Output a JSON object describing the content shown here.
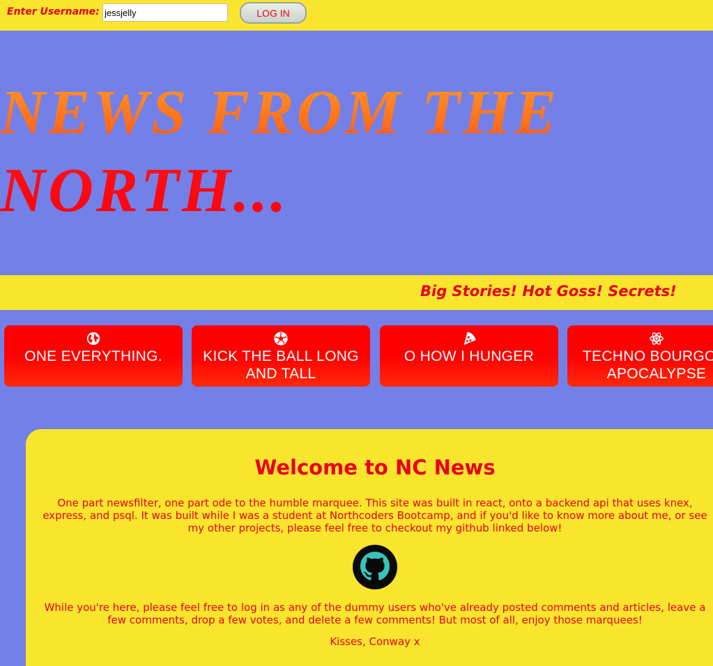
{
  "login": {
    "label": "Enter Username:",
    "username_value": "jessjelly",
    "button_label": "LOG IN"
  },
  "hero": {
    "title": "NEWS FROM THE NORTH..."
  },
  "marquee": {
    "text": "Big Stories! Hot Goss! Secrets!"
  },
  "topics": [
    {
      "label": "ONE EVERYTHING.",
      "icon": "globe-icon"
    },
    {
      "label": "KICK THE BALL LONG AND TALL",
      "icon": "football-icon"
    },
    {
      "label": "O HOW I HUNGER",
      "icon": "pizza-icon"
    },
    {
      "label": "TECHNO BOURGOIS APOCALYPSE",
      "icon": "atom-icon"
    }
  ],
  "welcome": {
    "title": "Welcome to NC News",
    "intro": "One part newsfilter, one part ode to the humble marquee. This site was built in react, onto a backend api that uses knex, express, and psql. It was built while I was a student at Northcoders Bootcamp, and if you'd like to know more about me, or see my other projects, please feel free to checkout my github linked below!",
    "github_icon": "github-icon",
    "invite": "While you're here, please feel free to log in as any of the dummy users who've already posted comments and articles, leave a few comments, drop a few votes, and delete a few comments! But most of all, enjoy those marquees!",
    "signoff": "Kisses, Conway x"
  },
  "colors": {
    "primary_yellow": "#f9e52e",
    "background_blue": "#7380e8",
    "accent_red": "#e8001c",
    "button_red": "#ff0000",
    "title_orange": "#ff8c1a"
  }
}
